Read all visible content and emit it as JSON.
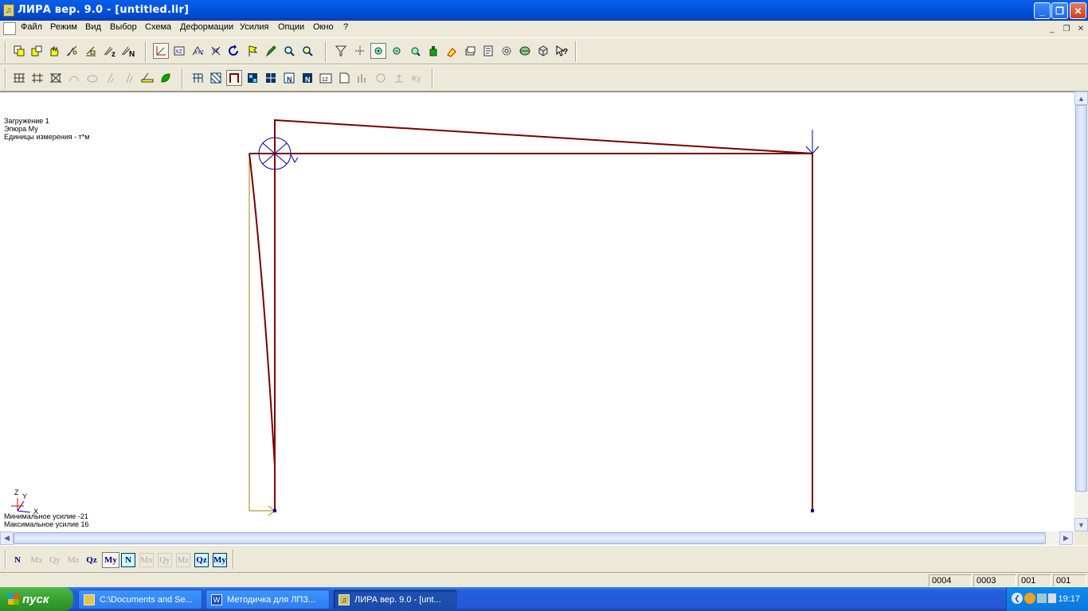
{
  "window": {
    "title": "ЛИРА  вер. 9.0 - [untitled.lir]",
    "app_icon": "lyre-icon",
    "buttons": {
      "minimize": "_",
      "maximize": "❐",
      "close": "✕"
    }
  },
  "menu": {
    "items": [
      "Файл",
      "Режим",
      "Вид",
      "Выбор",
      "Схема",
      "Деформации",
      "Усилия",
      "Опции",
      "Окно",
      "?"
    ],
    "mdi_buttons": [
      "_",
      "❐",
      "✕"
    ]
  },
  "toolbar1": {
    "icons": [
      "copy-scheme-icon",
      "paste-scheme-icon",
      "hand-icon",
      "nodes-icon",
      "bars-icon",
      "sigma-z-icon",
      "sigma-n-icon",
      "axes-icon",
      "xz-view-icon",
      "xyz-view-icon",
      "yz-view-icon",
      "rotate-icon",
      "flag-icon",
      "pencil-icon",
      "zoom-icon",
      "zoom-fit-icon",
      "filter-icon",
      "select-nodes-icon",
      "zoom-in-icon",
      "zoom-out-icon",
      "zoom-window-icon",
      "bottle-icon",
      "paint-icon",
      "layers-icon",
      "edit-icon",
      "gear-icon",
      "globe-icon",
      "cube-icon",
      "help-cursor-icon"
    ]
  },
  "toolbar2": {
    "icons": [
      "grid-frame-icon",
      "grid-frame2-icon",
      "grid-frame3-icon",
      "arc-icon",
      "ellipse-icon",
      "line-icon",
      "line2-icon",
      "bar-icon",
      "leaf-icon",
      "mesh-icon",
      "diagonal-mesh-icon",
      "frame-diagram-icon",
      "quad-mesh-icon",
      "mesh-dark-icon",
      "mesh-n-icon",
      "mesh-n2-icon",
      "numbers-icon",
      "document-icon",
      "chart-icon",
      "settings-icon",
      "pin-icon",
      "ky-icon"
    ]
  },
  "canvas_info": {
    "load_case": "Загружение  1",
    "diagram": "Эпюра Му",
    "units": "Единицы измерения - т*м",
    "min_force": "Минимальное усилие  -21",
    "max_force": "Максимальное усилие  16",
    "axis_labels": {
      "z": "Z",
      "y": "Y",
      "x": "X"
    }
  },
  "colors": {
    "frame": "#800000",
    "diagram": "#7a0000",
    "axis_red": "#e00000",
    "axis_blue": "#0000a0",
    "axis_yellow": "#a08000",
    "window_title": "#0054e3"
  },
  "force_toolbar": {
    "items": [
      "N",
      "Mx",
      "Qy",
      "Mz",
      "Qz",
      "My",
      "N",
      "Mx",
      "Qy",
      "Mz",
      "Qz",
      "My"
    ]
  },
  "status": {
    "cells": [
      "0004",
      "0003",
      "001",
      "001"
    ]
  },
  "taskbar": {
    "start": "пуск",
    "tasks": [
      "C:\\Documents and Se...",
      "Методичка для ЛПЗ...",
      "ЛИРА  вер. 9.0 - [unt..."
    ],
    "clock": "19:17"
  }
}
